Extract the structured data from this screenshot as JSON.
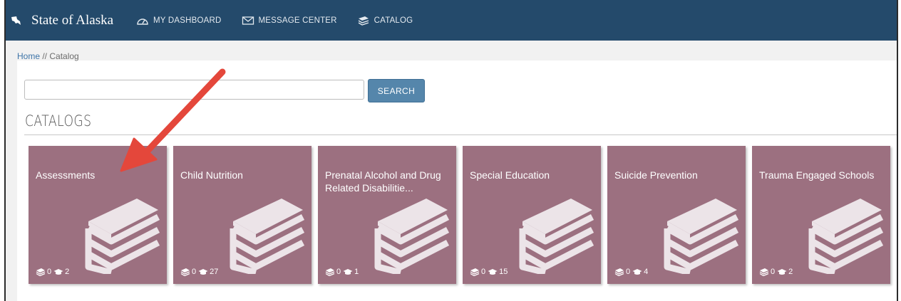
{
  "navbar": {
    "brand": "State of Alaska",
    "items": [
      {
        "label": "MY DASHBOARD",
        "icon": "dashboard-icon"
      },
      {
        "label": "MESSAGE CENTER",
        "icon": "envelope-icon"
      },
      {
        "label": "CATALOG",
        "icon": "books-icon"
      }
    ]
  },
  "breadcrumb": {
    "home": "Home",
    "separator": " // ",
    "current": "Catalog"
  },
  "search": {
    "value": "",
    "placeholder": "",
    "button_label": "SEARCH"
  },
  "section_title": "CATALOGS",
  "tiles": [
    {
      "title": "Assessments",
      "stat_a": "0",
      "stat_b": "2"
    },
    {
      "title": "Child Nutrition",
      "stat_a": "0",
      "stat_b": "27"
    },
    {
      "title": "Prenatal Alcohol and Drug Related Disabilitie...",
      "stat_a": "0",
      "stat_b": "1"
    },
    {
      "title": "Special Education",
      "stat_a": "0",
      "stat_b": "15"
    },
    {
      "title": "Suicide Prevention",
      "stat_a": "0",
      "stat_b": "4"
    },
    {
      "title": "Trauma Engaged Schools",
      "stat_a": "0",
      "stat_b": "2"
    }
  ],
  "colors": {
    "navbar": "#244a6b",
    "tile": "#9c7080",
    "button": "#5586ab",
    "arrow": "#e4473b"
  }
}
